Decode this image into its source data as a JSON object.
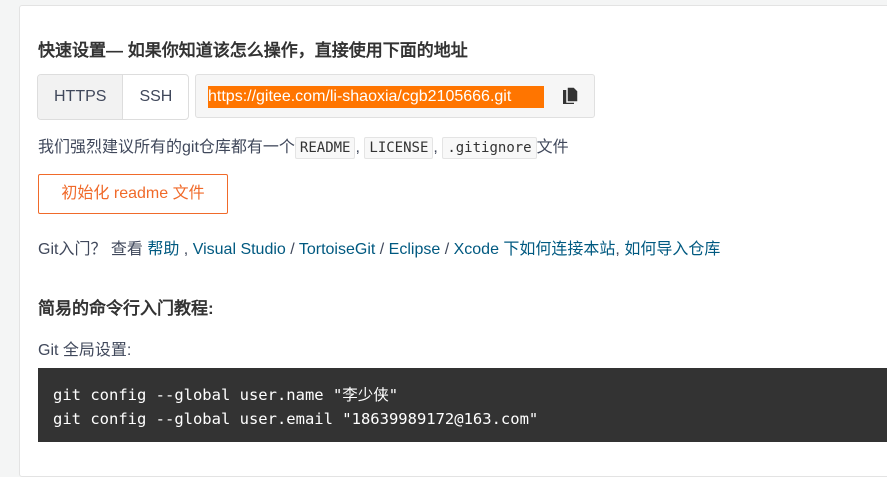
{
  "title": "快速设置— 如果你知道该怎么操作，直接使用下面的地址",
  "protocol_tabs": [
    "HTTPS",
    "SSH"
  ],
  "repo_url": "https://gitee.com/li-shaoxia/cgb2105666.git",
  "recommend": {
    "prefix": "我们强烈建议所有的git仓库都有一个",
    "files": [
      "README",
      "LICENSE",
      ".gitignore"
    ],
    "sep": ",",
    "suffix": "文件"
  },
  "init_button": "初始化 readme 文件",
  "help": {
    "prefix": "Git入门？ 查看 ",
    "help_link": "帮助",
    "sep1": " , ",
    "vs": "Visual Studio",
    "slash": " / ",
    "tortoise": "TortoiseGit",
    "eclipse": "Eclipse",
    "xcode": "Xcode 下如何连接本站",
    "sep2": ", ",
    "import": "如何导入仓库"
  },
  "tutorial_title": "简易的命令行入门教程:",
  "global_label": "Git 全局设置:",
  "commands": [
    "git config --global user.name \"李少侠\"",
    "git config --global user.email \"18639989172@163.com\""
  ]
}
